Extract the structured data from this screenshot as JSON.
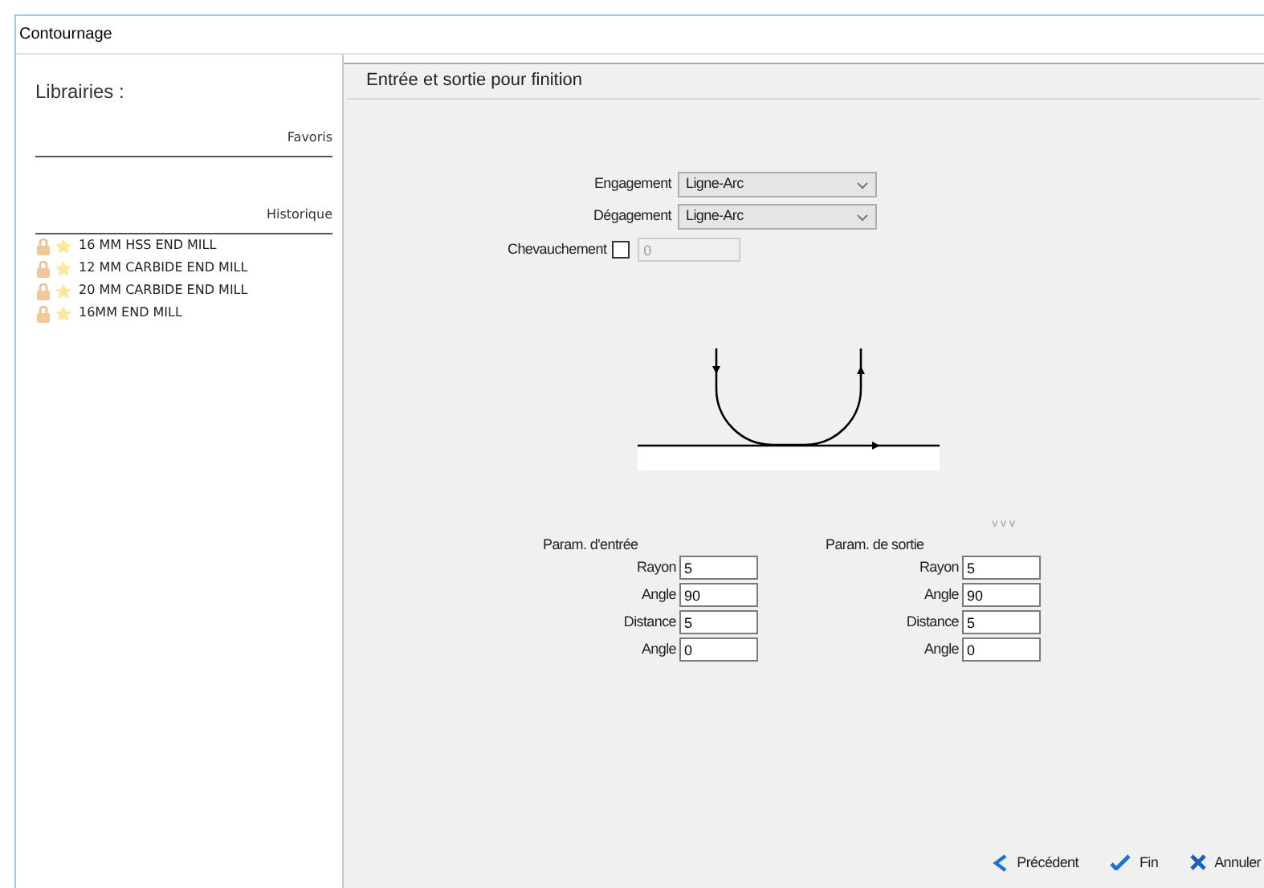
{
  "window": {
    "title": "Contournage"
  },
  "sidebar": {
    "title": "Librairies :",
    "sections": [
      {
        "label": "Favoris"
      },
      {
        "label": "Historique",
        "items": [
          {
            "label": "16 MM HSS END MILL"
          },
          {
            "label": "12 MM CARBIDE END MILL"
          },
          {
            "label": "20 MM CARBIDE END MILL"
          },
          {
            "label": "16MM END MILL"
          }
        ]
      }
    ]
  },
  "panel": {
    "title": "Entrée et sortie pour finition",
    "engagement": {
      "label": "Engagement",
      "value": "Ligne-Arc"
    },
    "degagement": {
      "label": "Dégagement",
      "value": "Ligne-Arc"
    },
    "overlap": {
      "label": "Chevauchement",
      "checked": false,
      "value": "0",
      "disabled": true
    },
    "chevrons": "v v v",
    "params": [
      {
        "title": "Param. d'entrée",
        "fields": [
          {
            "label": "Rayon",
            "value": "5"
          },
          {
            "label": "Angle",
            "value": "90"
          },
          {
            "label": "Distance",
            "value": "5"
          },
          {
            "label": "Angle",
            "value": "0"
          }
        ]
      },
      {
        "title": "Param. de sortie",
        "fields": [
          {
            "label": "Rayon",
            "value": "5"
          },
          {
            "label": "Angle",
            "value": "90"
          },
          {
            "label": "Distance",
            "value": "5"
          },
          {
            "label": "Angle",
            "value": "0"
          }
        ]
      }
    ]
  },
  "buttons": [
    {
      "kind": "back",
      "label": "Précédent"
    },
    {
      "kind": "finish",
      "label": "Fin"
    },
    {
      "kind": "cancel",
      "label": "Annuler"
    }
  ]
}
